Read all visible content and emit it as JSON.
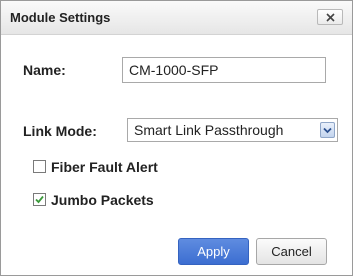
{
  "dialog": {
    "title": "Module Settings",
    "close_icon": "close-icon"
  },
  "form": {
    "name_label": "Name:",
    "name_value": "CM-1000-SFP",
    "link_mode_label": "Link Mode:",
    "link_mode_value": "Smart Link Passthrough",
    "fiber_fault_label": "Fiber Fault Alert",
    "fiber_fault_checked": false,
    "jumbo_label": "Jumbo Packets",
    "jumbo_checked": true
  },
  "buttons": {
    "apply_label": "Apply",
    "cancel_label": "Cancel"
  },
  "colors": {
    "accent": "#4a7ad8",
    "check": "#3a9a3a"
  }
}
